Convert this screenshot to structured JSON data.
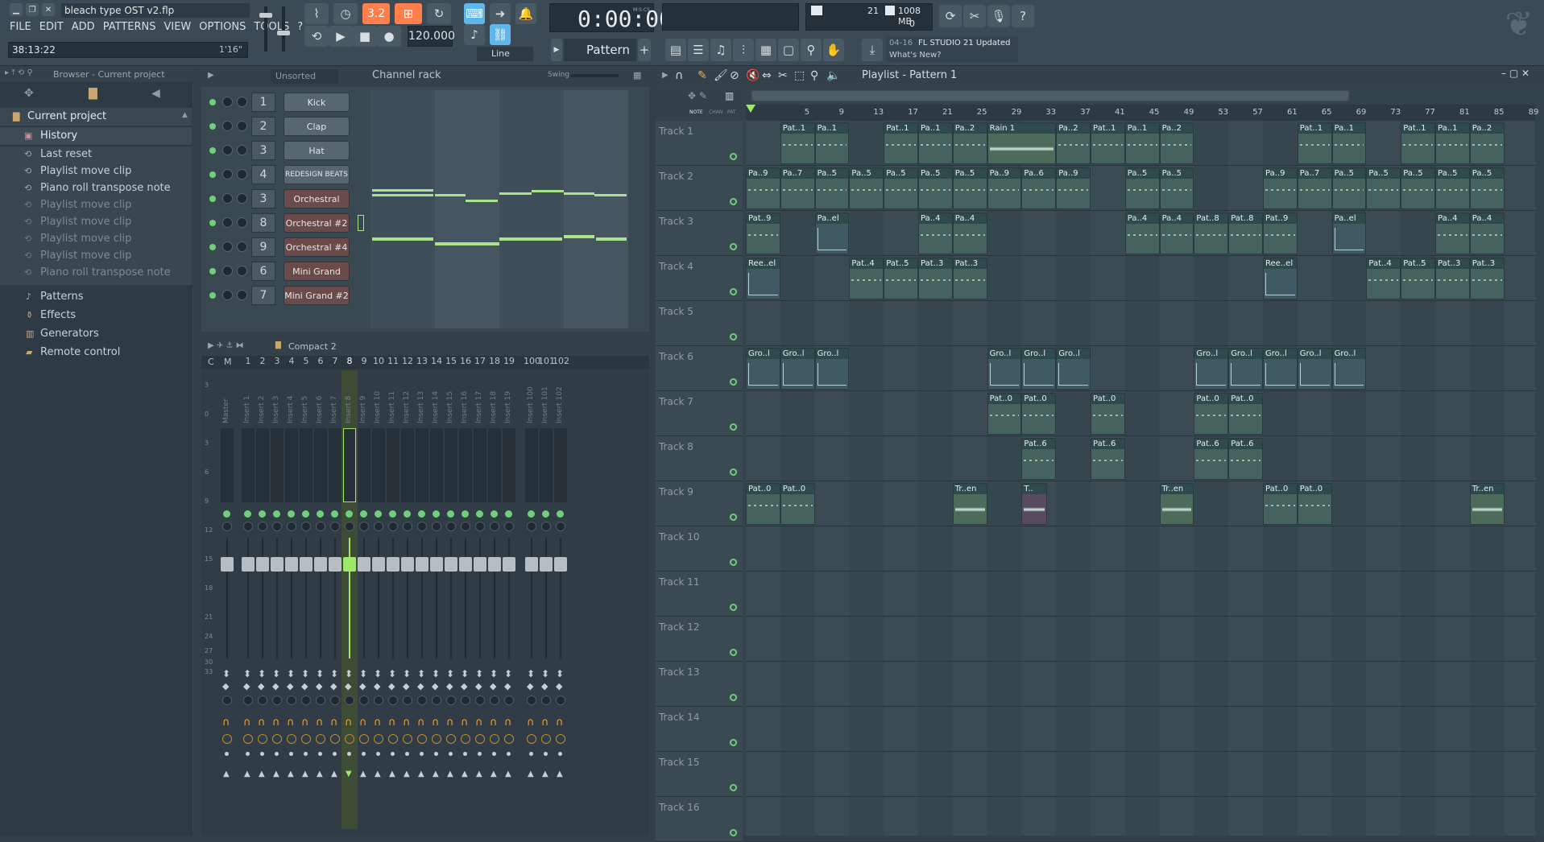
{
  "window": {
    "title": "bleach type OST v2.flp",
    "time_display": "38:13:22",
    "time_alt": "1'16\""
  },
  "menu": [
    "FILE",
    "EDIT",
    "ADD",
    "PATTERNS",
    "VIEW",
    "OPTIONS",
    "TOOLS",
    "?"
  ],
  "transport": {
    "time": "0:00:00",
    "time_unit": "M:S:CS",
    "tempo": "120.000",
    "pattern": "Pattern 1",
    "snap": "Line",
    "cpu_value": "21",
    "memory": "1008 MB",
    "voices": "0",
    "beat_box": "3.2"
  },
  "news": {
    "date": "04-16",
    "headline": "FL STUDIO 21 Updated",
    "link": "What's New?"
  },
  "browser": {
    "header": "Browser - Current project",
    "root": "Current project",
    "history_label": "History",
    "history": [
      {
        "label": "Last reset",
        "dim": false
      },
      {
        "label": "Playlist move clip",
        "dim": false
      },
      {
        "label": "Piano roll transpose note",
        "dim": false
      },
      {
        "label": "Playlist move clip",
        "dim": true
      },
      {
        "label": "Playlist move clip",
        "dim": true
      },
      {
        "label": "Playlist move clip",
        "dim": true
      },
      {
        "label": "Playlist move clip",
        "dim": true
      },
      {
        "label": "Piano roll transpose note",
        "dim": true
      }
    ],
    "folders": [
      "Patterns",
      "Effects",
      "Generators",
      "Remote control"
    ]
  },
  "channel_rack": {
    "title": "Channel rack",
    "filter": "Unsorted",
    "swing_label": "Swing",
    "channels": [
      {
        "num": "1",
        "name": "Kick",
        "red": false
      },
      {
        "num": "2",
        "name": "Clap",
        "red": false
      },
      {
        "num": "3",
        "name": "Hat",
        "red": false
      },
      {
        "num": "4",
        "name": "REDESIGN BEATS",
        "red": false
      },
      {
        "num": "3",
        "name": "Orchestral",
        "red": true
      },
      {
        "num": "8",
        "name": "Orchestral #2",
        "red": true
      },
      {
        "num": "9",
        "name": "Orchestral #4",
        "red": true
      },
      {
        "num": "6",
        "name": "Mini Grand",
        "red": true
      },
      {
        "num": "7",
        "name": "Mini Grand #2",
        "red": true
      }
    ]
  },
  "mixer": {
    "layout": "Compact 2",
    "header_cm": [
      "C",
      "M"
    ],
    "strip_numbers": [
      "1",
      "2",
      "3",
      "4",
      "5",
      "6",
      "7",
      "8",
      "9",
      "10",
      "11",
      "12",
      "13",
      "14",
      "15",
      "16",
      "17",
      "18",
      "19"
    ],
    "extra_numbers": [
      "100",
      "101",
      "102"
    ],
    "master_label": "Master",
    "insert_labels": [
      "Insert 1",
      "Insert 2",
      "Insert 3",
      "Insert 4",
      "Insert 5",
      "Insert 6",
      "Insert 7",
      "Insert 8",
      "Insert 9",
      "Insert 10",
      "Insert 11",
      "Insert 12",
      "Insert 13",
      "Insert 14",
      "Insert 15",
      "Insert 16",
      "Insert 17",
      "Insert 18",
      "Insert 19"
    ],
    "extra_labels": [
      "Insert 100",
      "Insert 101",
      "Insert 102"
    ],
    "db_scale": [
      "3",
      "0",
      "3",
      "6",
      "9",
      "12",
      "15",
      "18",
      "21",
      "24",
      "27",
      "30",
      "33"
    ],
    "selected_index": 7
  },
  "playlist": {
    "title": "Playlist - Pattern 1",
    "mode_labels": [
      "NOTE",
      "CHAN",
      "PAT"
    ],
    "bars": [
      "5",
      "9",
      "13",
      "17",
      "21",
      "25",
      "29",
      "33",
      "37",
      "41",
      "45",
      "49",
      "53",
      "57",
      "61",
      "65",
      "69",
      "73",
      "77",
      "81",
      "85",
      "89"
    ],
    "tracks": [
      "Track 1",
      "Track 2",
      "Track 3",
      "Track 4",
      "Track 5",
      "Track 6",
      "Track 7",
      "Track 8",
      "Track 9",
      "Track 10",
      "Track 11",
      "Track 12",
      "Track 13",
      "Track 14",
      "Track 15",
      "Track 16"
    ],
    "clips": [
      {
        "track": 0,
        "start": 5,
        "len": 4,
        "label": "Pat..1",
        "kind": "pat"
      },
      {
        "track": 0,
        "start": 9,
        "len": 4,
        "label": "Pa..1",
        "kind": "pat"
      },
      {
        "track": 0,
        "start": 17,
        "len": 4,
        "label": "Pat..1",
        "kind": "pat"
      },
      {
        "track": 0,
        "start": 21,
        "len": 4,
        "label": "Pa..1",
        "kind": "pat"
      },
      {
        "track": 0,
        "start": 25,
        "len": 4,
        "label": "Pa..2",
        "kind": "pat"
      },
      {
        "track": 0,
        "start": 29,
        "len": 8,
        "label": "Rain 1",
        "kind": "audio"
      },
      {
        "track": 0,
        "start": 37,
        "len": 4,
        "label": "Pa..2",
        "kind": "pat"
      },
      {
        "track": 0,
        "start": 41,
        "len": 4,
        "label": "Pat..1",
        "kind": "pat"
      },
      {
        "track": 0,
        "start": 45,
        "len": 4,
        "label": "Pa..1",
        "kind": "pat"
      },
      {
        "track": 0,
        "start": 49,
        "len": 4,
        "label": "Pa..2",
        "kind": "pat"
      },
      {
        "track": 0,
        "start": 65,
        "len": 4,
        "label": "Pat..1",
        "kind": "pat"
      },
      {
        "track": 0,
        "start": 69,
        "len": 4,
        "label": "Pa..1",
        "kind": "pat"
      },
      {
        "track": 0,
        "start": 77,
        "len": 4,
        "label": "Pat..1",
        "kind": "pat"
      },
      {
        "track": 0,
        "start": 81,
        "len": 4,
        "label": "Pa..1",
        "kind": "pat"
      },
      {
        "track": 0,
        "start": 85,
        "len": 4,
        "label": "Pa..2",
        "kind": "pat"
      },
      {
        "track": 1,
        "start": 1,
        "len": 4,
        "label": "Pa..9",
        "kind": "pat"
      },
      {
        "track": 1,
        "start": 5,
        "len": 4,
        "label": "Pa..7",
        "kind": "pat"
      },
      {
        "track": 1,
        "start": 9,
        "len": 4,
        "label": "Pa..5",
        "kind": "pat"
      },
      {
        "track": 1,
        "start": 13,
        "len": 4,
        "label": "Pa..5",
        "kind": "pat"
      },
      {
        "track": 1,
        "start": 17,
        "len": 4,
        "label": "Pa..5",
        "kind": "pat"
      },
      {
        "track": 1,
        "start": 21,
        "len": 4,
        "label": "Pa..5",
        "kind": "pat"
      },
      {
        "track": 1,
        "start": 25,
        "len": 4,
        "label": "Pa..5",
        "kind": "pat"
      },
      {
        "track": 1,
        "start": 29,
        "len": 4,
        "label": "Pa..9",
        "kind": "pat"
      },
      {
        "track": 1,
        "start": 33,
        "len": 4,
        "label": "Pa..6",
        "kind": "pat"
      },
      {
        "track": 1,
        "start": 37,
        "len": 4,
        "label": "Pa..9",
        "kind": "pat"
      },
      {
        "track": 1,
        "start": 45,
        "len": 4,
        "label": "Pa..5",
        "kind": "pat"
      },
      {
        "track": 1,
        "start": 49,
        "len": 4,
        "label": "Pa..5",
        "kind": "pat"
      },
      {
        "track": 1,
        "start": 61,
        "len": 4,
        "label": "Pa..9",
        "kind": "pat"
      },
      {
        "track": 1,
        "start": 65,
        "len": 4,
        "label": "Pa..7",
        "kind": "pat"
      },
      {
        "track": 1,
        "start": 69,
        "len": 4,
        "label": "Pa..5",
        "kind": "pat"
      },
      {
        "track": 1,
        "start": 73,
        "len": 4,
        "label": "Pa..5",
        "kind": "pat"
      },
      {
        "track": 1,
        "start": 77,
        "len": 4,
        "label": "Pa..5",
        "kind": "pat"
      },
      {
        "track": 1,
        "start": 81,
        "len": 4,
        "label": "Pa..5",
        "kind": "pat"
      },
      {
        "track": 1,
        "start": 85,
        "len": 4,
        "label": "Pa..5",
        "kind": "pat"
      },
      {
        "track": 2,
        "start": 1,
        "len": 4,
        "label": "Pat..9",
        "kind": "pat"
      },
      {
        "track": 2,
        "start": 9,
        "len": 4,
        "label": "Pa..el",
        "kind": "auto"
      },
      {
        "track": 2,
        "start": 21,
        "len": 4,
        "label": "Pa..4",
        "kind": "pat"
      },
      {
        "track": 2,
        "start": 25,
        "len": 4,
        "label": "Pa..4",
        "kind": "pat"
      },
      {
        "track": 2,
        "start": 45,
        "len": 4,
        "label": "Pa..4",
        "kind": "pat"
      },
      {
        "track": 2,
        "start": 49,
        "len": 4,
        "label": "Pa..4",
        "kind": "pat"
      },
      {
        "track": 2,
        "start": 53,
        "len": 4,
        "label": "Pat..8",
        "kind": "pat"
      },
      {
        "track": 2,
        "start": 57,
        "len": 4,
        "label": "Pat..8",
        "kind": "pat"
      },
      {
        "track": 2,
        "start": 61,
        "len": 4,
        "label": "Pat..9",
        "kind": "pat"
      },
      {
        "track": 2,
        "start": 69,
        "len": 4,
        "label": "Pa..el",
        "kind": "auto"
      },
      {
        "track": 2,
        "start": 81,
        "len": 4,
        "label": "Pa..4",
        "kind": "pat"
      },
      {
        "track": 2,
        "start": 85,
        "len": 4,
        "label": "Pa..4",
        "kind": "pat"
      },
      {
        "track": 3,
        "start": 1,
        "len": 4,
        "label": "Ree..el",
        "kind": "auto"
      },
      {
        "track": 3,
        "start": 13,
        "len": 4,
        "label": "Pat..4",
        "kind": "pat"
      },
      {
        "track": 3,
        "start": 17,
        "len": 4,
        "label": "Pat..5",
        "kind": "pat"
      },
      {
        "track": 3,
        "start": 21,
        "len": 4,
        "label": "Pat..3",
        "kind": "pat"
      },
      {
        "track": 3,
        "start": 25,
        "len": 4,
        "label": "Pat..3",
        "kind": "pat"
      },
      {
        "track": 3,
        "start": 61,
        "len": 4,
        "label": "Ree..el",
        "kind": "auto"
      },
      {
        "track": 3,
        "start": 73,
        "len": 4,
        "label": "Pat..4",
        "kind": "pat"
      },
      {
        "track": 3,
        "start": 77,
        "len": 4,
        "label": "Pat..5",
        "kind": "pat"
      },
      {
        "track": 3,
        "start": 81,
        "len": 4,
        "label": "Pat..3",
        "kind": "pat"
      },
      {
        "track": 3,
        "start": 85,
        "len": 4,
        "label": "Pat..3",
        "kind": "pat"
      },
      {
        "track": 5,
        "start": 1,
        "len": 4,
        "label": "Gro..l",
        "kind": "auto"
      },
      {
        "track": 5,
        "start": 5,
        "len": 4,
        "label": "Gro..l",
        "kind": "auto"
      },
      {
        "track": 5,
        "start": 9,
        "len": 4,
        "label": "Gro..l",
        "kind": "auto"
      },
      {
        "track": 5,
        "start": 29,
        "len": 4,
        "label": "Gro..l",
        "kind": "auto"
      },
      {
        "track": 5,
        "start": 33,
        "len": 4,
        "label": "Gro..l",
        "kind": "auto"
      },
      {
        "track": 5,
        "start": 37,
        "len": 4,
        "label": "Gro..l",
        "kind": "auto"
      },
      {
        "track": 5,
        "start": 53,
        "len": 4,
        "label": "Gro..l",
        "kind": "auto"
      },
      {
        "track": 5,
        "start": 57,
        "len": 4,
        "label": "Gro..l",
        "kind": "auto"
      },
      {
        "track": 5,
        "start": 61,
        "len": 4,
        "label": "Gro..l",
        "kind": "auto"
      },
      {
        "track": 5,
        "start": 65,
        "len": 4,
        "label": "Gro..l",
        "kind": "auto"
      },
      {
        "track": 5,
        "start": 69,
        "len": 4,
        "label": "Gro..l",
        "kind": "auto"
      },
      {
        "track": 6,
        "start": 29,
        "len": 4,
        "label": "Pat..0",
        "kind": "pat"
      },
      {
        "track": 6,
        "start": 33,
        "len": 4,
        "label": "Pat..0",
        "kind": "pat"
      },
      {
        "track": 6,
        "start": 41,
        "len": 4,
        "label": "Pat..0",
        "kind": "pat"
      },
      {
        "track": 6,
        "start": 53,
        "len": 4,
        "label": "Pat..0",
        "kind": "pat"
      },
      {
        "track": 6,
        "start": 57,
        "len": 4,
        "label": "Pat..0",
        "kind": "pat"
      },
      {
        "track": 7,
        "start": 33,
        "len": 4,
        "label": "Pat..6",
        "kind": "pat"
      },
      {
        "track": 7,
        "start": 41,
        "len": 4,
        "label": "Pat..6",
        "kind": "pat"
      },
      {
        "track": 7,
        "start": 53,
        "len": 4,
        "label": "Pat..6",
        "kind": "pat"
      },
      {
        "track": 7,
        "start": 57,
        "len": 4,
        "label": "Pat..6",
        "kind": "pat"
      },
      {
        "track": 8,
        "start": 1,
        "len": 4,
        "label": "Pat..0",
        "kind": "pat"
      },
      {
        "track": 8,
        "start": 5,
        "len": 4,
        "label": "Pat..0",
        "kind": "pat"
      },
      {
        "track": 8,
        "start": 25,
        "len": 4,
        "label": "Tr..en",
        "kind": "audio"
      },
      {
        "track": 8,
        "start": 33,
        "len": 3,
        "label": "T..",
        "kind": "audio2"
      },
      {
        "track": 8,
        "start": 49,
        "len": 4,
        "label": "Tr..en",
        "kind": "audio"
      },
      {
        "track": 8,
        "start": 61,
        "len": 4,
        "label": "Pat..0",
        "kind": "pat"
      },
      {
        "track": 8,
        "start": 65,
        "len": 4,
        "label": "Pat..0",
        "kind": "pat"
      },
      {
        "track": 8,
        "start": 85,
        "len": 4,
        "label": "Tr..en",
        "kind": "audio"
      }
    ]
  },
  "colors": {
    "accent_green": "#9ee86a",
    "lcd_orange": "#ff7e4a",
    "pattern_clip": "#45625f",
    "audio_clip": "#4d6b5b",
    "auto_clip": "#405a64"
  }
}
